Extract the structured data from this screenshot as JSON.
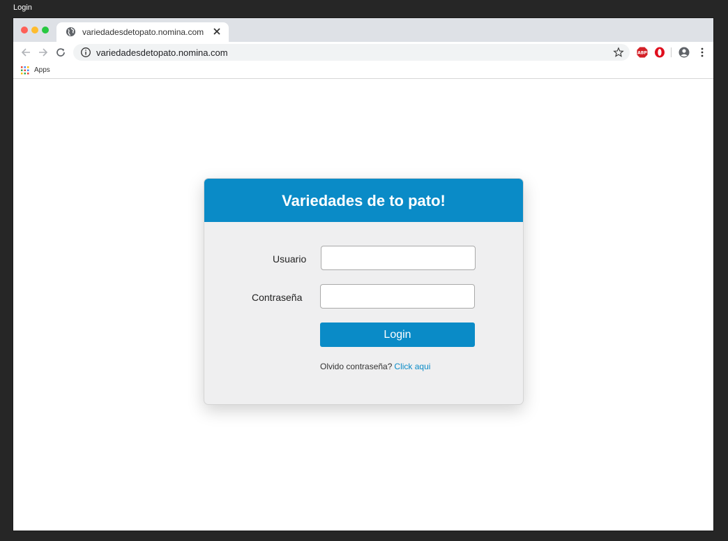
{
  "window": {
    "title": "Login"
  },
  "tab": {
    "title": "variedadesdetopato.nomina.com"
  },
  "omnibox": {
    "url": "variedadesdetopato.nomina.com"
  },
  "bookmarks": {
    "apps_label": "Apps"
  },
  "login": {
    "heading": "Variedades de to pato!",
    "username_label": "Usuario",
    "password_label": "Contraseña",
    "button_label": "Login",
    "forgot_text": "Olvido contraseña?",
    "forgot_link": "Click aqui"
  },
  "colors": {
    "brand_blue": "#0a8bc7",
    "card_background": "#efeff0",
    "frame": "#262626"
  },
  "icons": [
    "globe-icon",
    "close-icon",
    "back-arrow-icon",
    "forward-arrow-icon",
    "reload-icon",
    "info-icon",
    "star-icon",
    "adblock-icon",
    "opera-icon",
    "account-icon",
    "menu-dots-icon",
    "apps-grid-icon"
  ]
}
